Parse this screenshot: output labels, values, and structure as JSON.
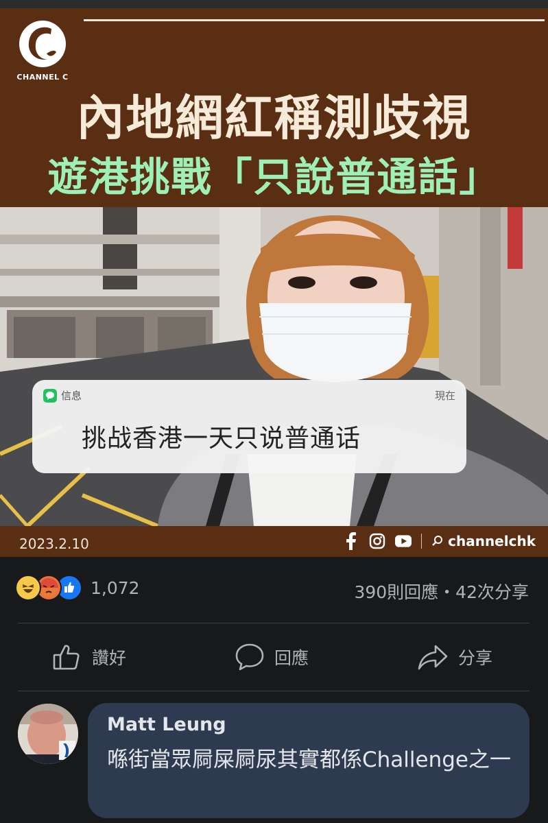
{
  "post_image": {
    "brand": "CHANNEL C",
    "headline_line1": "內地網紅稱測歧視",
    "headline_line2": "遊港挑戰「只說普通話」",
    "notification": {
      "app_name": "信息",
      "time": "現在",
      "message": "挑战香港一天只说普通话"
    },
    "date": "2023.2.10",
    "social_icons": [
      "facebook-icon",
      "instagram-icon",
      "youtube-icon"
    ],
    "handle": "channelchk",
    "colors": {
      "background": "#5a2e12",
      "headline_green": "#9ef0b7",
      "headline_cream": "#f6ead8"
    }
  },
  "reactions": {
    "emoji_types": [
      "haha",
      "angry",
      "like"
    ],
    "count": "1,072",
    "stats": "390則回應・42次分享"
  },
  "actions": [
    {
      "icon": "thumbs-up-icon",
      "label": "讚好"
    },
    {
      "icon": "comment-icon",
      "label": "回應"
    },
    {
      "icon": "share-icon",
      "label": "分享"
    }
  ],
  "comment": {
    "author": "Matt Leung",
    "text": "喺街當眾屙屎屙尿其實都係Challenge之一"
  }
}
